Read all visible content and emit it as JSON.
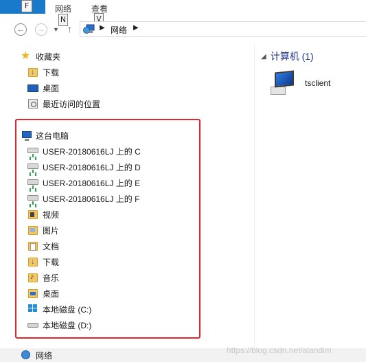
{
  "ribbon": {
    "file_keytip": "F",
    "tabs": [
      {
        "label": "网络",
        "keytip": "N"
      },
      {
        "label": "查看",
        "keytip": "V"
      }
    ]
  },
  "address_bar": {
    "crumb": "网络"
  },
  "nav_pane": {
    "favorites": {
      "label": "收藏夹",
      "items": [
        {
          "label": "下载",
          "icon": "download-folder-icon"
        },
        {
          "label": "桌面",
          "icon": "desktop-icon"
        },
        {
          "label": "最近访问的位置",
          "icon": "recent-places-icon"
        }
      ]
    },
    "this_pc": {
      "label": "这台电脑",
      "items": [
        {
          "label": "USER-20180616LJ 上的 C",
          "icon": "network-drive-icon"
        },
        {
          "label": "USER-20180616LJ 上的 D",
          "icon": "network-drive-icon"
        },
        {
          "label": "USER-20180616LJ 上的 E",
          "icon": "network-drive-icon"
        },
        {
          "label": "USER-20180616LJ 上的 F",
          "icon": "network-drive-icon"
        },
        {
          "label": "视频",
          "icon": "videos-folder-icon"
        },
        {
          "label": "图片",
          "icon": "pictures-folder-icon"
        },
        {
          "label": "文档",
          "icon": "documents-folder-icon"
        },
        {
          "label": "下载",
          "icon": "download-folder-icon"
        },
        {
          "label": "音乐",
          "icon": "music-folder-icon"
        },
        {
          "label": "桌面",
          "icon": "desktop-folder-icon"
        },
        {
          "label": "本地磁盘 (C:)",
          "icon": "windows-drive-icon"
        },
        {
          "label": "本地磁盘 (D:)",
          "icon": "hard-drive-icon"
        }
      ]
    },
    "network": {
      "label": "网络"
    }
  },
  "content": {
    "group_title": "计算机 (1)",
    "items": [
      {
        "label": "tsclient",
        "icon": "computer-icon"
      }
    ]
  },
  "watermark": "https://blog.csdn.net/alandim",
  "colors": {
    "file_tab": "#1979ca",
    "highlight_box": "#e0262e",
    "group_title": "#1e3287"
  }
}
